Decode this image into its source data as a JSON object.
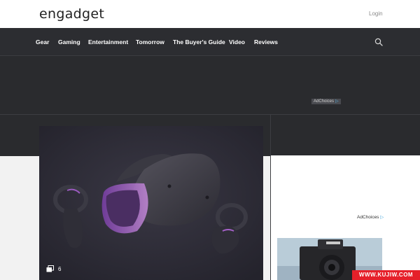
{
  "header": {
    "logo_text": "engadget",
    "login_label": "Login"
  },
  "nav": {
    "items": [
      {
        "label": "Gear"
      },
      {
        "label": "Gaming"
      },
      {
        "label": "Entertainment"
      },
      {
        "label": "Tomorrow"
      },
      {
        "label": "The Buyer's Guide"
      },
      {
        "label": "Video"
      },
      {
        "label": "Reviews"
      }
    ],
    "search_icon": "search-icon"
  },
  "ads": {
    "top_adchoices_label": "AdChoices",
    "sidebar_adchoices_label": "AdChoices",
    "adchoices_icon": "adchoices-triangle-icon"
  },
  "hero": {
    "gallery_icon": "gallery-stack-icon",
    "gallery_count": "6"
  },
  "watermark": {
    "text": "WWW.KUJIW.COM"
  },
  "colors": {
    "nav_background": "#2c2d31",
    "page_background": "#f2f2f2",
    "watermark_red": "#e6202a"
  }
}
